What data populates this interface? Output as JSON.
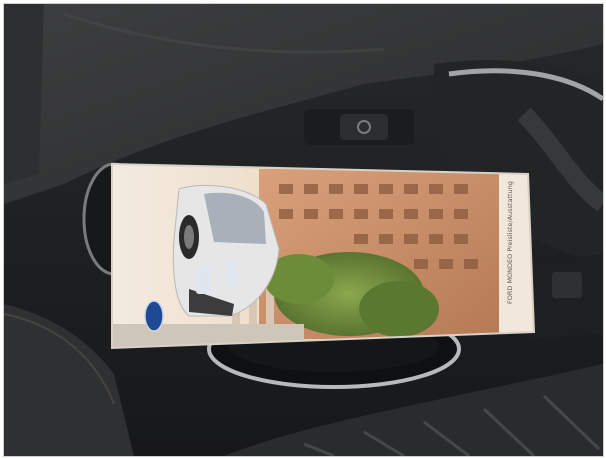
{
  "image": {
    "kind": "photo",
    "subject": "Ford brochure on car center console",
    "colors": {
      "console_dark": "#1f2021",
      "console_mid": "#2d2f31",
      "seat_fabric": "#3a3b3c",
      "chrome": "#b9bcc0",
      "brochure_edge": "#e9e6e1",
      "sky": "#efe3d3",
      "building": "#c98f66",
      "tree": "#6f8e3c",
      "car_white": "#e6e6e6",
      "ford_blue": "#1d4a93"
    }
  },
  "brochure": {
    "spine_text": "FORD MONDEO Preisliste/Ausstattung",
    "logo_text": "Ford"
  }
}
